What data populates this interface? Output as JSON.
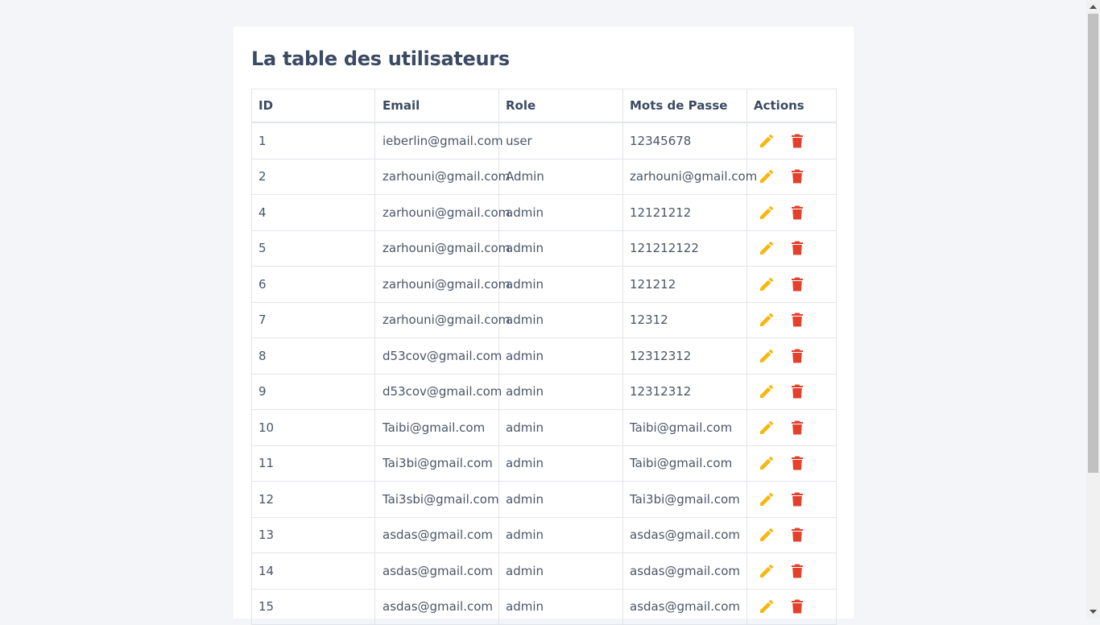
{
  "page": {
    "title": "La table des utilisateurs"
  },
  "table": {
    "headers": {
      "id": "ID",
      "email": "Email",
      "role": "Role",
      "password": "Mots de Passe",
      "actions": "Actions"
    },
    "rows": [
      {
        "id": "1",
        "email": "ieberlin@gmail.com",
        "role": "user",
        "password": "12345678"
      },
      {
        "id": "2",
        "email": "zarhouni@gmail.com",
        "role": "Admin",
        "password": "zarhouni@gmail.com"
      },
      {
        "id": "4",
        "email": "zarhouni@gmail.com",
        "role": "admin",
        "password": "12121212"
      },
      {
        "id": "5",
        "email": "zarhouni@gmail.com",
        "role": "admin",
        "password": "121212122"
      },
      {
        "id": "6",
        "email": "zarhouni@gmail.com",
        "role": "admin",
        "password": "121212"
      },
      {
        "id": "7",
        "email": "zarhouni@gmail.com",
        "role": "admin",
        "password": "12312"
      },
      {
        "id": "8",
        "email": "d53cov@gmail.com",
        "role": "admin",
        "password": "12312312"
      },
      {
        "id": "9",
        "email": "d53cov@gmail.com",
        "role": "admin",
        "password": "12312312"
      },
      {
        "id": "10",
        "email": "Taibi@gmail.com",
        "role": "admin",
        "password": "Taibi@gmail.com"
      },
      {
        "id": "11",
        "email": "Tai3bi@gmail.com",
        "role": "admin",
        "password": "Taibi@gmail.com"
      },
      {
        "id": "12",
        "email": "Tai3sbi@gmail.com",
        "role": "admin",
        "password": "Tai3bi@gmail.com"
      },
      {
        "id": "13",
        "email": "asdas@gmail.com",
        "role": "admin",
        "password": "asdas@gmail.com"
      },
      {
        "id": "14",
        "email": "asdas@gmail.com",
        "role": "admin",
        "password": "asdas@gmail.com"
      },
      {
        "id": "15",
        "email": "asdas@gmail.com",
        "role": "admin",
        "password": "asdas@gmail.com"
      }
    ]
  },
  "icons": {
    "edit": "pencil-icon",
    "delete": "trash-icon"
  },
  "colors": {
    "edit_icon": "#f5b80f",
    "delete_icon": "#e3412b",
    "title": "#3b4a63",
    "background": "#f3f5f9"
  }
}
